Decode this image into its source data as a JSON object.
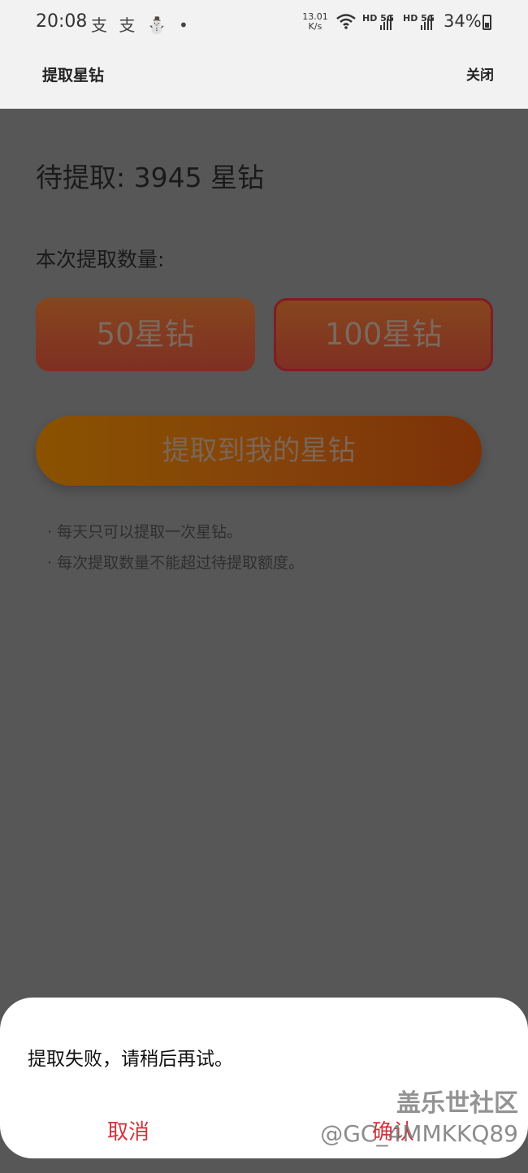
{
  "status_bar": {
    "time": "20:08",
    "notification_icons": "支 支 ⛄ •",
    "net_speed_value": "13.01",
    "net_speed_unit": "K/s",
    "signal1_label": "HD 5G",
    "signal2_label": "HD 5G",
    "battery_percent": "34%"
  },
  "header": {
    "title": "提取星钻",
    "close_label": "关闭"
  },
  "main": {
    "pending_text": "待提取: 3945 星钻",
    "amount_label": "本次提取数量:",
    "options": [
      {
        "label": "50星钻",
        "selected": false
      },
      {
        "label": "100星钻",
        "selected": true
      }
    ],
    "extract_button": "提取到我的星钻",
    "notes": [
      "· 每天只可以提取一次星钻。",
      "· 每次提取数量不能超过待提取额度。"
    ]
  },
  "dialog": {
    "message": "提取失败，请稍后再试。",
    "cancel_label": "取消",
    "confirm_label": "确认"
  },
  "watermark": {
    "line1": "盖乐世社区",
    "line2": "@GC_4MMKKQ89"
  },
  "colors": {
    "accent_red": "#d2323a",
    "overlay_bg": "#575757",
    "header_bg": "#f2f2f2"
  }
}
